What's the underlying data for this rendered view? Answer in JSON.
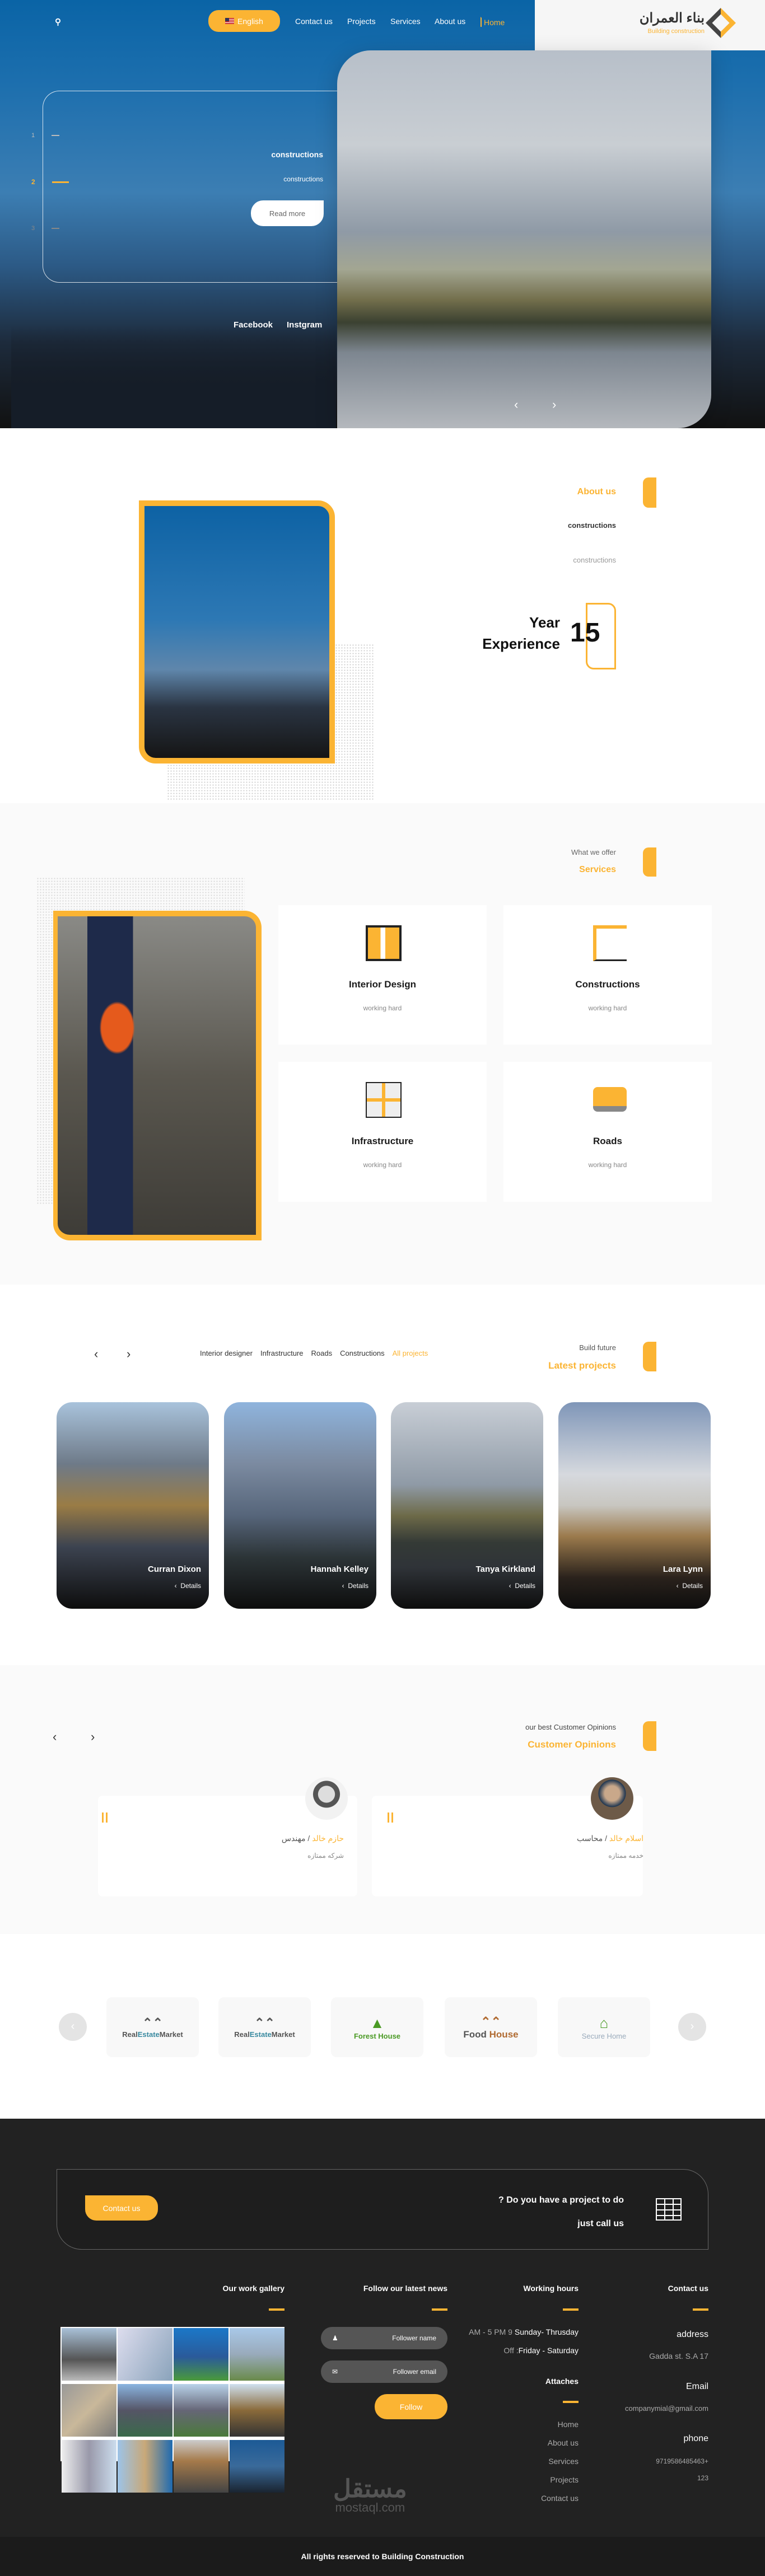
{
  "nav": {
    "search_icon": "search-icon",
    "language": "English",
    "items": [
      "Contact us",
      "Projects",
      "Services",
      "About us",
      "Home"
    ],
    "active": "Home"
  },
  "logo": {
    "arabic": "بناء العمران",
    "english": "Building construction"
  },
  "hero": {
    "title": "constructions",
    "subtitle": "constructions",
    "read_more": "Read more",
    "slides": [
      "1",
      "2",
      "3"
    ],
    "active_slide": 2,
    "social": [
      "Facebook",
      "Instgram"
    ],
    "prev": "‹",
    "next": "›"
  },
  "about": {
    "label": "About us",
    "line1": "constructions",
    "line2": "constructions",
    "years": "15",
    "year_label": "Year",
    "experience_label": "Experience"
  },
  "services": {
    "kicker": "What we offer",
    "title": "Services",
    "items": [
      {
        "title": "Interior Design",
        "sub": "working hard"
      },
      {
        "title": "Constructions",
        "sub": "working hard"
      },
      {
        "title": "Infrastructure",
        "sub": "working hard"
      },
      {
        "title": "Roads",
        "sub": "working hard"
      }
    ]
  },
  "projects": {
    "kicker": "Build future",
    "title": "Latest projects",
    "filters": [
      "Interior designer",
      "Infrastructure",
      "Roads",
      "Constructions",
      "All projects"
    ],
    "active_filter": "All projects",
    "items": [
      {
        "name": "Curran Dixon",
        "details": "Details"
      },
      {
        "name": "Hannah Kelley",
        "details": "Details"
      },
      {
        "name": "Tanya Kirkland",
        "details": "Details"
      },
      {
        "name": "Lara Lynn",
        "details": "Details"
      }
    ]
  },
  "opinions": {
    "kicker": "our best Customer Opinions",
    "title": "Customer Opinions",
    "items": [
      {
        "name": "حازم خالد",
        "role": "/ مهندس",
        "text": "شركه ممتازه"
      },
      {
        "name": "اسلام خالد",
        "role": "/ محاسب",
        "text": "خدمه ممتازه"
      }
    ]
  },
  "partners": {
    "items": [
      {
        "a": "Real",
        "b": "Estate",
        "c": "Market"
      },
      {
        "a": "Real",
        "b": "Estate",
        "c": "Market"
      },
      {
        "a": "Forest House",
        "b": "",
        "c": ""
      },
      {
        "a": "Food",
        "b": " House",
        "c": ""
      },
      {
        "a": "Secure Home",
        "b": "",
        "c": ""
      }
    ]
  },
  "cta": {
    "question": "? Do you have a project to do",
    "call": "just call us",
    "button": "Contact us"
  },
  "footer": {
    "gallery_title": "Our work gallery",
    "news_title": "Follow our latest news",
    "name_placeholder": "Follower name",
    "email_placeholder": "Follower email",
    "follow": "Follow",
    "hours_title": "Working hours",
    "hours1_time": "AM - 5 PM 9",
    "hours1_days": "Sunday- Thrusday",
    "hours2_label": "Off :",
    "hours2_days": "Friday - Saturday",
    "links_title": "Attaches",
    "links": [
      "Home",
      "About us",
      "Services",
      "Projects",
      "Contact us"
    ],
    "contact_title": "Contact us",
    "address_label": "address",
    "address": "Gadda st. S.A 17",
    "email_label": "Email",
    "email": "companymial@gmail.com",
    "phone_label": "phone",
    "phone": "9719586485463+",
    "phone2": "123",
    "watermark_ar": "مستقل",
    "watermark_en": "mostaql.com",
    "copyright": "All rights reserved to Building Construction"
  },
  "colors": {
    "accent": "#fbb433",
    "nav_blue": "#0a64a6",
    "dark": "#222222"
  }
}
